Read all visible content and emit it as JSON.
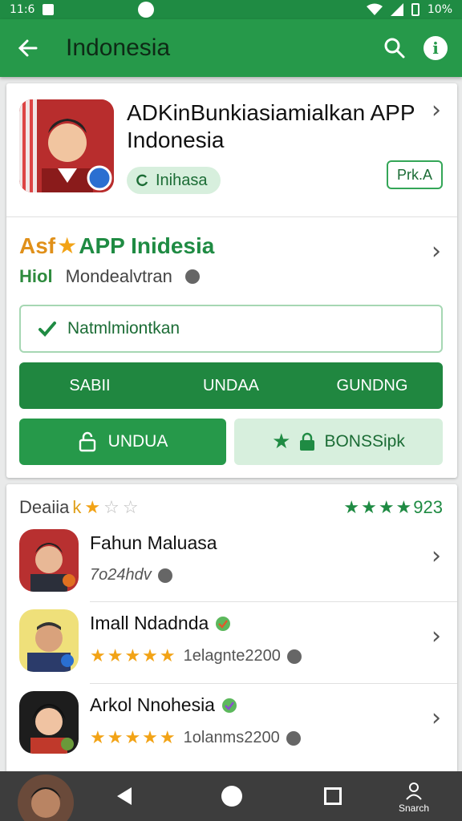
{
  "status_bar": {
    "time": "11:6",
    "right_text": "10%"
  },
  "app_bar": {
    "title": "Indonesia"
  },
  "app": {
    "title": "ADKinBunkiasiamialkan APP Indonesia",
    "chip_label": "Inihasa",
    "badge_label": "Prk.A"
  },
  "profile": {
    "prefix": "Asf",
    "name": "APP Inidesia",
    "hint": "Hiol",
    "subtitle": "Mondealvtran"
  },
  "actions": {
    "outline_label": "Natmlmiontkan",
    "segments": [
      "SABII",
      "UNDAA",
      "GUNDNG"
    ],
    "primary_label": "UNDUA",
    "secondary_label": "BONSSipk"
  },
  "reviews": {
    "head_label": "Deaiia",
    "head_k": "k",
    "score_label": "923",
    "items": [
      {
        "name": "Fahun Maluasa",
        "meta": "7o24hdv",
        "rated": false
      },
      {
        "name": "Imall Ndadnda",
        "meta": "1elagnte2200",
        "rated": true
      },
      {
        "name": "Arkol Nnohesia",
        "meta": "1olanms2200",
        "rated": true
      }
    ]
  },
  "nav": {
    "search_label": "Snarch"
  },
  "colors": {
    "primary": "#26994a",
    "dark": "#1f8b43",
    "light": "#d7efdd",
    "star": "#f2a316"
  }
}
